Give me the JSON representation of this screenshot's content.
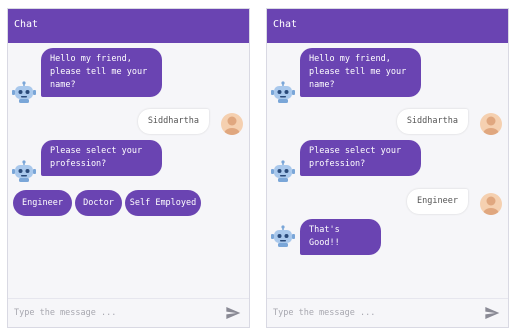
{
  "left_panel": {
    "header_title": "Chat",
    "bot_message_1": "Hello my friend,\nplease tell me your\nname?",
    "user_message_1": "Siddhartha",
    "bot_message_2": "Please select your\nprofession?",
    "choices": [
      "Engineer",
      "Doctor",
      "Self Employed"
    ],
    "input_placeholder": "Type the message ..."
  },
  "right_panel": {
    "header_title": "Chat",
    "bot_message_1": "Hello my friend,\nplease tell me your\nname?",
    "user_message_1": "Siddhartha",
    "bot_message_2": "Please select your\nprofession?",
    "user_message_2": "Engineer",
    "bot_message_3": "That's Good!!",
    "input_placeholder": "Type the message ..."
  },
  "icons": {
    "bot": "robot-avatar-icon",
    "user": "user-avatar-icon",
    "send": "send-icon"
  },
  "colors": {
    "accent": "#6a44b2",
    "panel_bg": "#f6f6f9",
    "user_bubble": "#ffffff"
  }
}
